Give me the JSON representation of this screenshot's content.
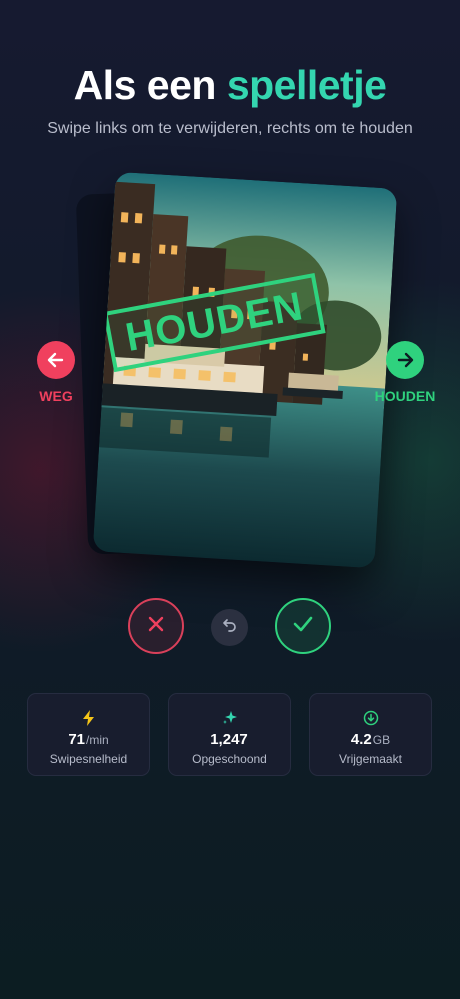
{
  "header": {
    "title_main": "Als een",
    "title_accent": "spelletje",
    "subtitle": "Swipe links om te verwijderen, rechts om te houden"
  },
  "card": {
    "stamp_label": "HOUDEN",
    "image_subject": "Amsterdam canal with houseboats at dusk"
  },
  "hints": {
    "left_label": "WEG",
    "left_icon": "arrow-left-icon",
    "right_label": "HOUDEN",
    "right_icon": "arrow-right-icon"
  },
  "actions": {
    "reject_icon": "close-icon",
    "undo_icon": "undo-icon",
    "keep_icon": "check-icon"
  },
  "stats": [
    {
      "icon": "lightning-icon",
      "value": "71",
      "unit": "/min",
      "label": "Swipesnelheid"
    },
    {
      "icon": "sparkle-icon",
      "value": "1,247",
      "unit": "",
      "label": "Opgeschoond"
    },
    {
      "icon": "download-circle-icon",
      "value": "4.2",
      "unit": "GB",
      "label": "Vrijgemaakt"
    }
  ],
  "colors": {
    "accent": "#34d6b0",
    "reject": "#f0405e",
    "keep": "#2fd27e",
    "background": "#131a2c"
  }
}
